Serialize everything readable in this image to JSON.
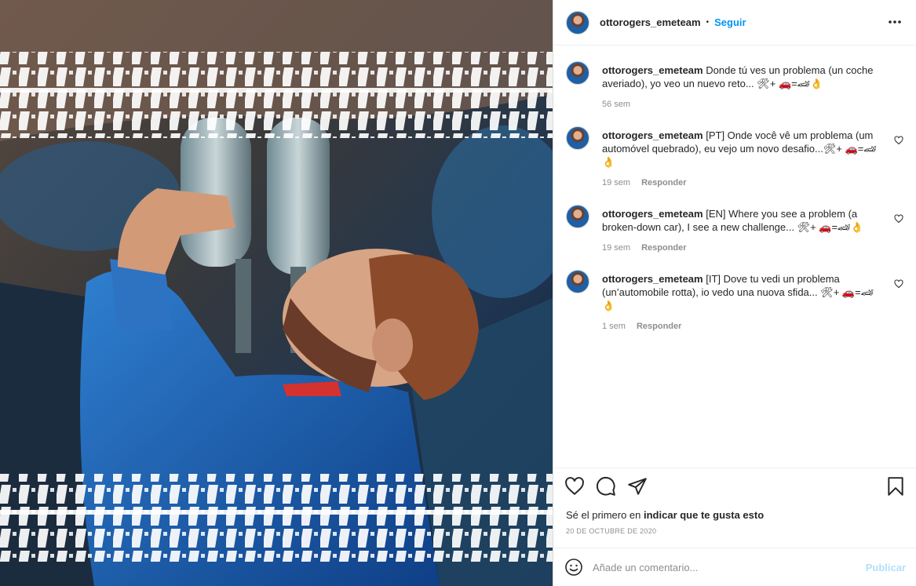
{
  "header": {
    "username": "ottorogers_emeteam",
    "separator": "•",
    "follow_label": "Seguir"
  },
  "comments": [
    {
      "username": "ottorogers_emeteam",
      "text": "Donde tú ves un problema (un coche averiado), yo veo un nuevo reto... 🛠+ 🚗=🏎👌",
      "time": "56 sem",
      "reply": ""
    },
    {
      "username": "ottorogers_emeteam",
      "text": "[PT] Onde você vê um problema (um automóvel quebrado), eu vejo um novo desafio...🛠+ 🚗=🏎👌",
      "time": "19 sem",
      "reply": "Responder"
    },
    {
      "username": "ottorogers_emeteam",
      "text": "[EN] Where you see a problem (a broken-down car), I see a new challenge... 🛠+ 🚗=🏎👌",
      "time": "19 sem",
      "reply": "Responder"
    },
    {
      "username": "ottorogers_emeteam",
      "text": "[IT] Dove tu vedi un problema (un’automobile rotta), io vedo una nuova sfida... 🛠+ 🚗=🏎👌",
      "time": "1 sem",
      "reply": "Responder"
    }
  ],
  "actions": {
    "likes_prefix": "Sé el primero en ",
    "likes_link": "indicar que te gusta esto",
    "date": "20 DE OCTUBRE DE 2020"
  },
  "add_comment": {
    "placeholder": "Añade un comentario...",
    "publish_label": "Publicar"
  },
  "icons": {
    "more": "more-dots-icon",
    "like": "heart-icon",
    "comment": "comment-bubble-icon",
    "share": "paper-plane-icon",
    "save": "bookmark-icon",
    "emoji": "smiley-icon"
  },
  "colors": {
    "accent": "#0095f6",
    "publish_disabled": "#b2dffc",
    "muted": "#8e8e8e",
    "text": "#262626"
  }
}
